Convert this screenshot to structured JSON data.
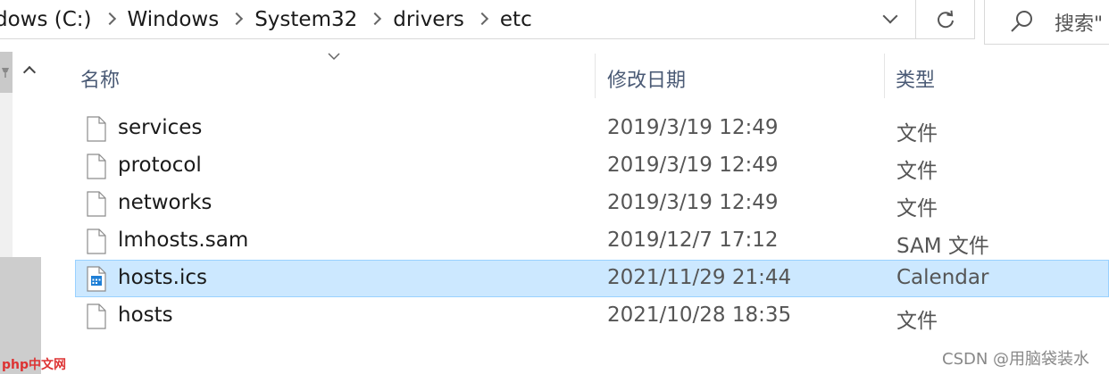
{
  "address_bar": {
    "breadcrumbs": [
      "dows (C:)",
      "Windows",
      "System32",
      "drivers",
      "etc"
    ]
  },
  "search": {
    "placeholder": "搜索\""
  },
  "columns": {
    "name": "名称",
    "date": "修改日期",
    "type": "类型"
  },
  "files": [
    {
      "name": "services",
      "date": "2019/3/19 12:49",
      "type": "文件",
      "icon": "blank-file-icon",
      "selected": false
    },
    {
      "name": "protocol",
      "date": "2019/3/19 12:49",
      "type": "文件",
      "icon": "blank-file-icon",
      "selected": false
    },
    {
      "name": "networks",
      "date": "2019/3/19 12:49",
      "type": "文件",
      "icon": "blank-file-icon",
      "selected": false
    },
    {
      "name": "lmhosts.sam",
      "date": "2019/12/7 17:12",
      "type": "SAM 文件",
      "icon": "blank-file-icon",
      "selected": false
    },
    {
      "name": "hosts.ics",
      "date": "2021/11/29 21:44",
      "type": "Calendar",
      "icon": "calendar-file-icon",
      "selected": true
    },
    {
      "name": "hosts",
      "date": "2021/10/28 18:35",
      "type": "文件",
      "icon": "blank-file-icon",
      "selected": false
    }
  ],
  "watermarks": {
    "left": "php中文网",
    "right": "CSDN @用脑袋装水"
  },
  "colors": {
    "selection_bg": "#cce8ff",
    "selection_border": "#99d1ff",
    "header_text": "#4a5a75",
    "calendar_icon": "#1e7fd6"
  }
}
